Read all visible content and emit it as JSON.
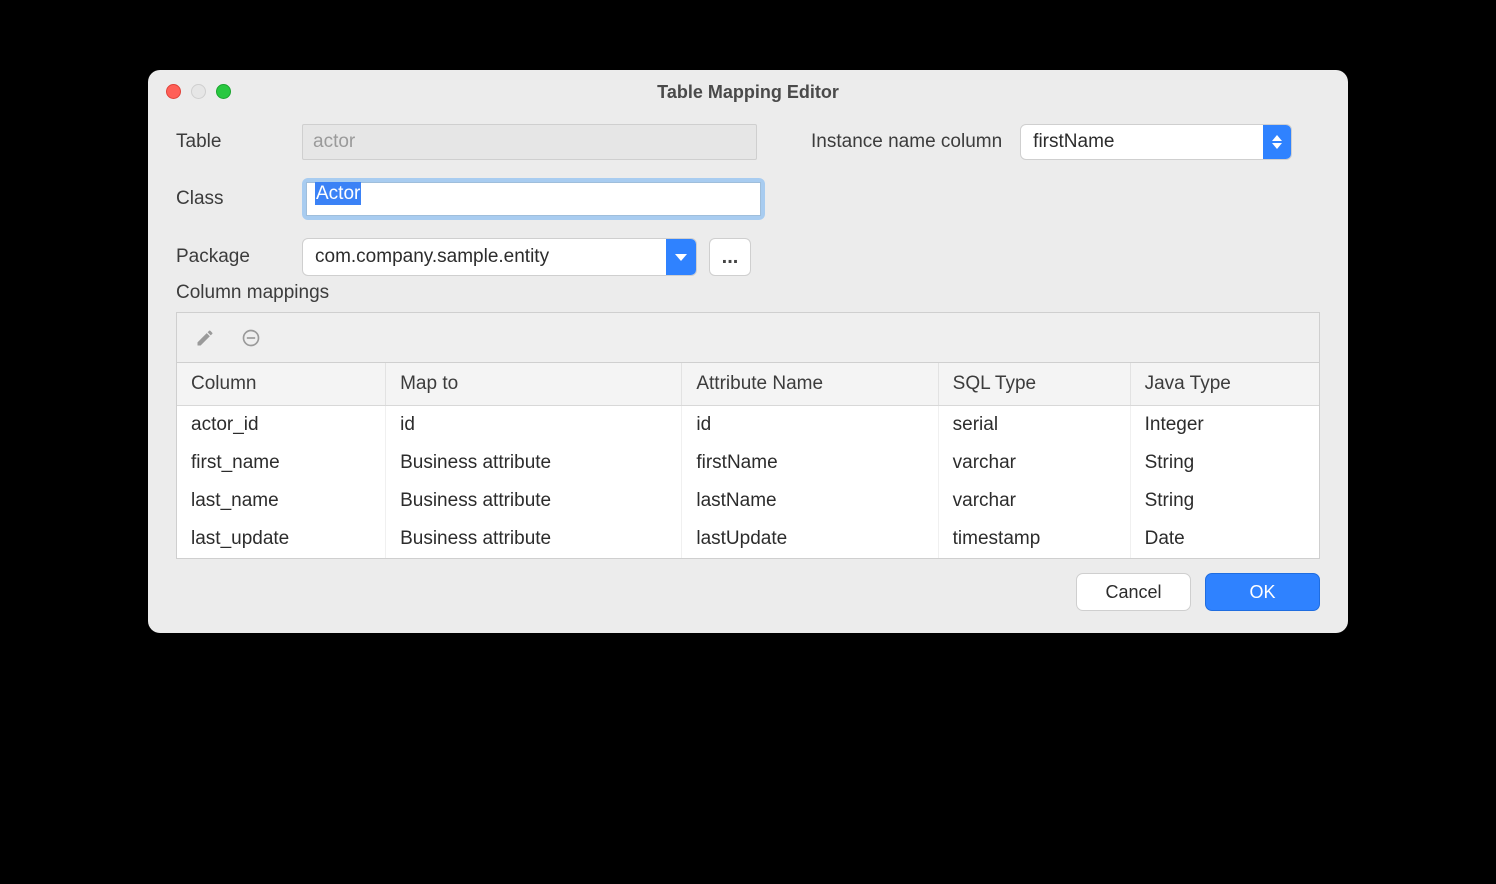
{
  "window": {
    "title": "Table Mapping Editor"
  },
  "form": {
    "table_label": "Table",
    "table_value": "actor",
    "class_label": "Class",
    "class_value": "Actor",
    "package_label": "Package",
    "package_value": "com.company.sample.entity",
    "browse_label": "...",
    "instance_label": "Instance name column",
    "instance_value": "firstName"
  },
  "mappings": {
    "section_label": "Column mappings",
    "headers": {
      "column": "Column",
      "map_to": "Map to",
      "attr": "Attribute Name",
      "sql": "SQL Type",
      "java": "Java Type"
    },
    "rows": [
      {
        "column": "actor_id",
        "map_to": "id",
        "attr": "id",
        "sql": "serial",
        "java": "Integer"
      },
      {
        "column": "first_name",
        "map_to": "Business attribute",
        "attr": "firstName",
        "sql": "varchar",
        "java": "String"
      },
      {
        "column": "last_name",
        "map_to": "Business attribute",
        "attr": "lastName",
        "sql": "varchar",
        "java": "String"
      },
      {
        "column": "last_update",
        "map_to": "Business attribute",
        "attr": "lastUpdate",
        "sql": "timestamp",
        "java": "Date"
      }
    ]
  },
  "buttons": {
    "cancel": "Cancel",
    "ok": "OK"
  }
}
